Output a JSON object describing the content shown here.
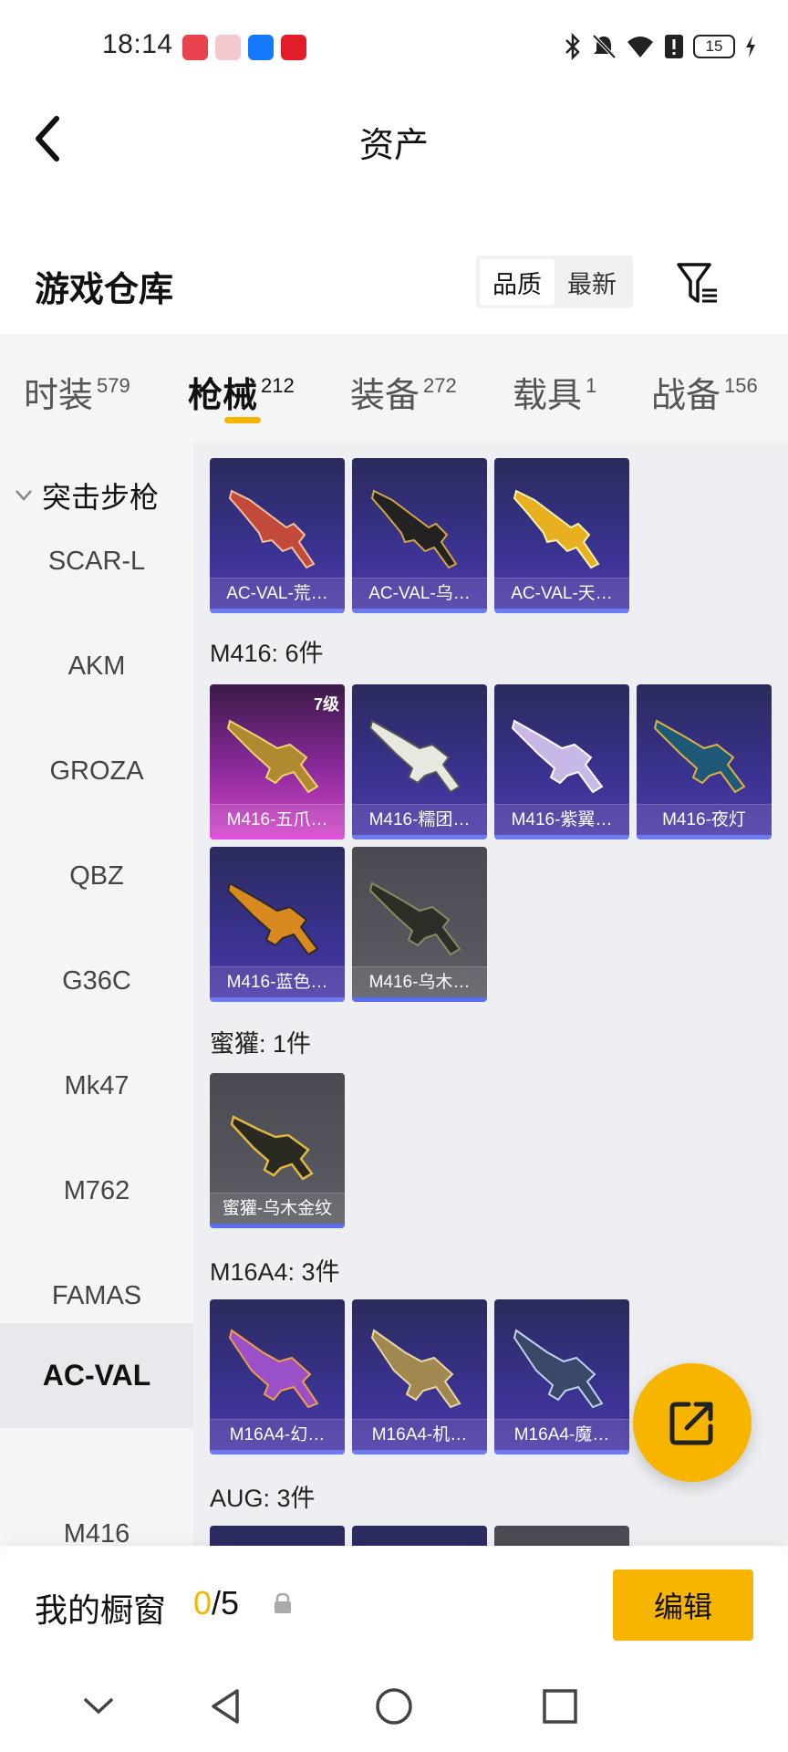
{
  "status_bar": {
    "time": "18:14",
    "battery": "15",
    "app_icons": [
      "huawei-icon",
      "store-icon",
      "alipay-icon",
      "redbag-icon"
    ],
    "right_icons": [
      "bluetooth-icon",
      "mute-bell-icon",
      "wifi-icon",
      "alert-icon",
      "battery-icon",
      "charging-icon"
    ]
  },
  "header": {
    "title": "资产"
  },
  "section": {
    "title": "游戏仓库",
    "sort_options": [
      "品质",
      "最新"
    ],
    "sort_active": "品质"
  },
  "tabs": [
    {
      "label": "时装",
      "count": "579"
    },
    {
      "label": "枪械",
      "count": "212"
    },
    {
      "label": "装备",
      "count": "272"
    },
    {
      "label": "载具",
      "count": "1"
    },
    {
      "label": "战备",
      "count": "156"
    }
  ],
  "active_tab": "枪械",
  "sidebar": {
    "group": "突击步枪",
    "items": [
      "SCAR-L",
      "AKM",
      "GROZA",
      "QBZ",
      "G36C",
      "Mk47",
      "M762",
      "FAMAS",
      "AC-VAL",
      "M416"
    ],
    "active": "AC-VAL"
  },
  "content": {
    "acval_items": [
      "AC-VAL-荒…",
      "AC-VAL-乌…",
      "AC-VAL-天…"
    ],
    "m416_label": "M416: 6件",
    "m416_items": [
      "M416-五爪…",
      "M416-糯团…",
      "M416-紫翼…",
      "M416-夜灯",
      "M416-蓝色…",
      "M416-乌木…"
    ],
    "m416_level": "7级",
    "mihuo_label": "蜜獾: 1件",
    "mihuo_items": [
      "蜜獾-乌木金纹"
    ],
    "m16_label": "M16A4: 3件",
    "m16_items": [
      "M16A4-幻…",
      "M16A4-机…",
      "M16A4-魔…"
    ],
    "aug_label": "AUG: 3件"
  },
  "showcase": {
    "label": "我的橱窗",
    "current": "0",
    "total": "/5",
    "edit_label": "编辑"
  },
  "colors": {
    "accent": "#f7b500",
    "card_blue": "#3a3290",
    "card_purple": "#d046c8",
    "card_gray": "#5c5d64"
  }
}
